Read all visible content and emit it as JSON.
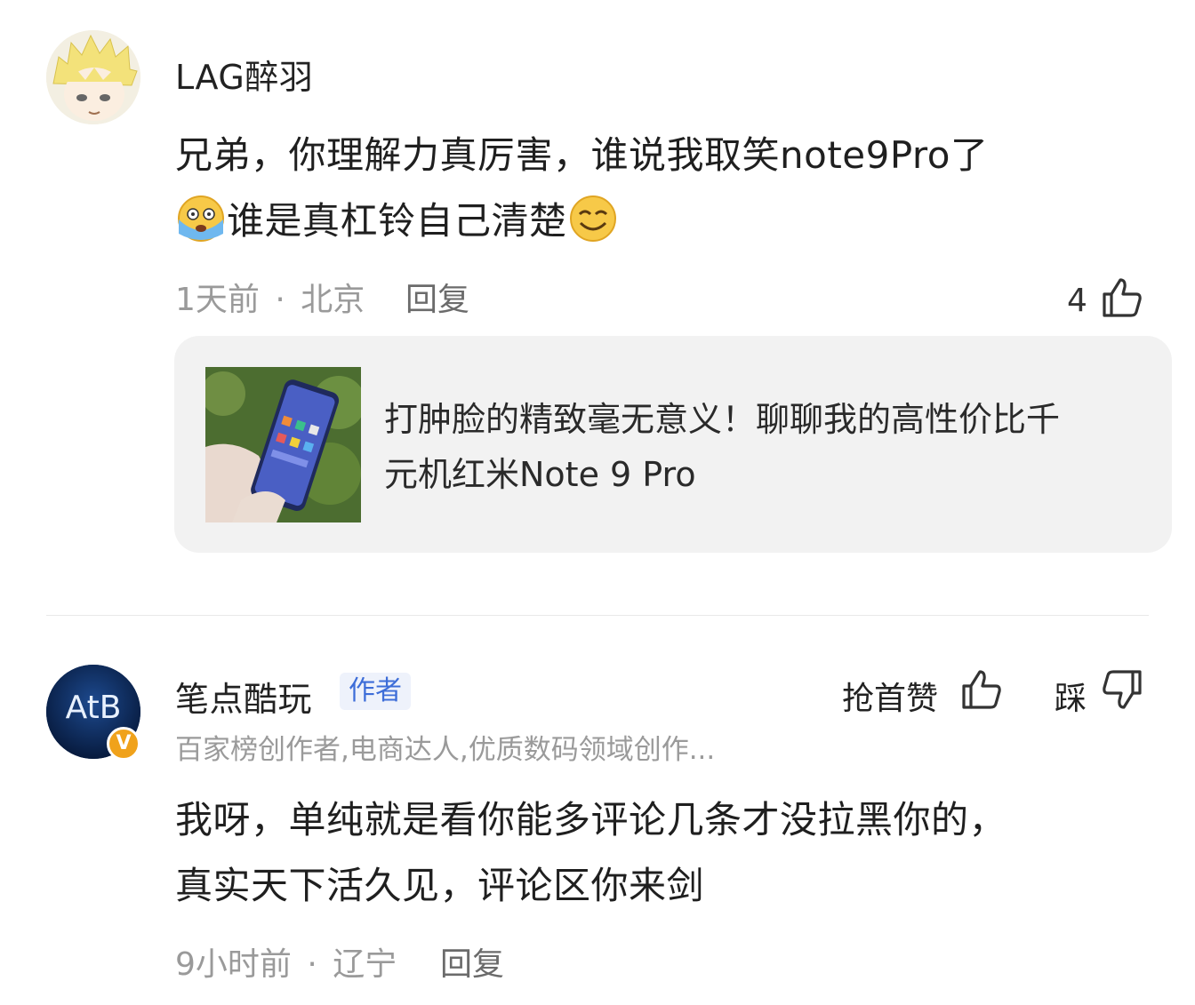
{
  "comments": [
    {
      "username": "LAG醉羽",
      "text_line1": "兄弟，你理解力真厉害，谁说我取笑note9Pro了",
      "text_line2": "谁是真杠铃自己清楚",
      "emoji_before": "scared-emoji",
      "emoji_after": "smirk-emoji",
      "time": "1天前",
      "location": "北京",
      "separator": "·",
      "reply_label": "回复",
      "like_count": "4",
      "quoted_article": {
        "title_line1": "打肿脸的精致毫无意义！聊聊我的高性价比千",
        "title_line2": "元机红米Note 9 Pro"
      }
    },
    {
      "username": "笔点酷玩",
      "badge": "作者",
      "description": "百家榜创作者,电商达人,优质数码领域创作...",
      "like_label": "抢首赞",
      "dislike_label": "踩",
      "text_line1": "我呀，单纯就是看你能多评论几条才没拉黑你的，",
      "text_line2": "真实天下活久见，评论区你来剑",
      "time": "9小时前",
      "location": "辽宁",
      "separator": "·",
      "reply_label": "回复",
      "avatar_text": "AtB",
      "verified_mark": "V"
    }
  ],
  "colors": {
    "card_bg": "#f2f2f2",
    "badge_text": "#3d6dd8",
    "verified": "#f0a21b"
  }
}
